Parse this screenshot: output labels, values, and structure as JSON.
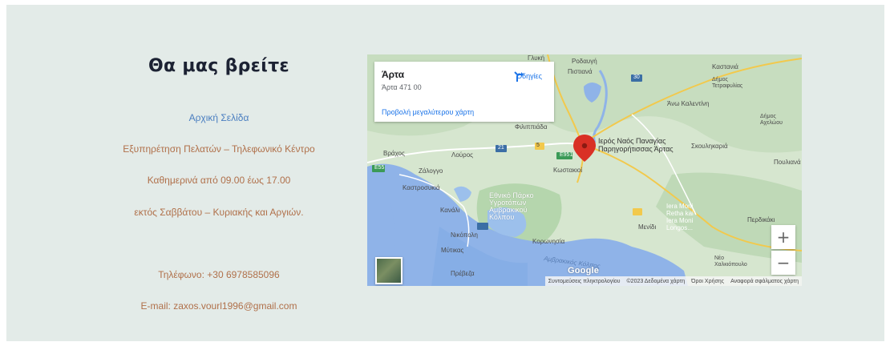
{
  "contact": {
    "title": "Θα μας βρείτε",
    "home_link": "Αρχική Σελίδα",
    "lines": [
      "Εξυπηρέτηση Πελατών – Τηλεφωνικό Κέντρο",
      "Καθημερινά από 09.00 έως 17.00",
      "εκτός Σαββάτου – Κυριακής και Αργιών.",
      "Τηλέφωνο: +30 6978585096",
      "E-mail: zaxos.vourl1996@gmail.com"
    ]
  },
  "map": {
    "card": {
      "title": "Άρτα",
      "address": "Άρτα 471 00",
      "directions": "Οδηγίες",
      "larger_map": "Προβολή μεγαλύτερου χάρτη"
    },
    "zoom_in": "+",
    "zoom_out": "−",
    "google": "Google",
    "footer": [
      "Συντομεύσεις πληκτρολογίου",
      "©2023 Δεδομένα χάρτη",
      "Όροι Χρήσης",
      "Αναφορά σφάλματος χάρτη"
    ],
    "labels": {
      "rodafgi": "Ροδαυγή",
      "pistiana": "Πιστιανά",
      "kastania": "Καστανιά",
      "dimos_tetrafylias": "Δήμος\nΤετραφυλίας",
      "ano_kalentini": "Άνω Καλεντίνη",
      "dimos_acheloou": "Δήμος\nΑχελώου",
      "filippiada": "Φιλιππιάδα",
      "ieros_naos": "Ιερός Ναός Παναγίας\nΠαρηγορήτισσας Άρτας",
      "skoulikaria": "Σκουληκαριά",
      "vrachos": "Βράχος",
      "louros": "Λούρος",
      "pouliana": "Πουλιανά",
      "zalongo": "Ζάλογγο",
      "kostakioi": "Κωστακιοί",
      "kastrosykia": "Καστροσυκιά",
      "ethniko_parko": "Εθνικό Πάρκο\nΥγροτόπων\nΑμβρακικού\nΚόλπου",
      "kanali": "Κανάλι",
      "nikopoli": "Νικόπολη",
      "ieras_moni": "Iera Moni\nRetha kai\nIera Moni\nLongos...",
      "menidi": "Μενίδι",
      "perdikaki": "Περδικάκι",
      "koronisia": "Κορωνησία",
      "mytikas": "Μύτικας",
      "amvrakikos": "Αμβρακικός Κόλπος",
      "preveza": "Πρέβεζα",
      "neo_chalkiopoulo": "Νέο\nΧαλκιόπουλο",
      "glyki": "Γλυκή",
      "road_e951": "E951",
      "road_21": "21",
      "road_30": "30",
      "road_5": "5",
      "road_e55": "E55"
    }
  }
}
